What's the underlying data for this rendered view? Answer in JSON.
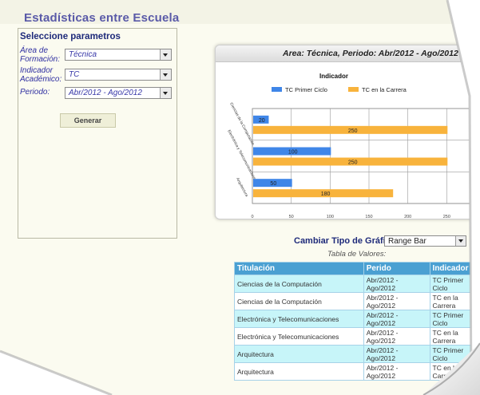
{
  "page": {
    "title": "Estadísticas entre Escuela"
  },
  "filters": {
    "header": "Seleccione parametros",
    "fields": [
      {
        "label": "Área de Formación:",
        "value": "Técnica"
      },
      {
        "label": "Indicador Académico:",
        "value": "TC"
      },
      {
        "label": "Periodo:",
        "value": "Abr/2012 - Ago/2012"
      }
    ],
    "generate_button": "Generar"
  },
  "chart_panel": {
    "title": "Area: Técnica, Periodo: Abr/2012 - Ago/2012"
  },
  "chart_data": {
    "type": "bar",
    "orientation": "horizontal",
    "title": "Indicador",
    "categories": [
      "Ciencias de la Computación",
      "Electrónica y Telecomunicaciones",
      "Arquitectura"
    ],
    "category_tick_labels": [
      "Ciencias de la Computación",
      "Electrónica y Telecomunicaciones",
      "Arquitectura"
    ],
    "series": [
      {
        "name": "TC Primer Ciclo",
        "values": [
          20,
          100,
          50
        ],
        "color": "#3f86e8"
      },
      {
        "name": "TC en la Carrera",
        "values": [
          250,
          250,
          180
        ],
        "color": "#f8b33c"
      }
    ],
    "data_labels": [
      [
        "20",
        "100",
        "50"
      ],
      [
        "250",
        "250",
        "180"
      ]
    ],
    "xlim": [
      0,
      300
    ],
    "x_ticks": [
      "0",
      "50",
      "100",
      "150",
      "200",
      "250"
    ],
    "grid": true,
    "legend_position": "top"
  },
  "chart_type_selector": {
    "label": "Cambiar Tipo de Gráfica:",
    "value": "Range Bar"
  },
  "table": {
    "caption": "Tabla de Valores:",
    "headers": [
      "Titulación",
      "Perido",
      "Indicador"
    ],
    "rows": [
      [
        "Ciencias de la Computación",
        "Abr/2012 - Ago/2012",
        "TC Primer Ciclo"
      ],
      [
        "Ciencias de la Computación",
        "Abr/2012 - Ago/2012",
        "TC en la Carrera"
      ],
      [
        "Electrónica y Telecomunicaciones",
        "Abr/2012 - Ago/2012",
        "TC Primer Ciclo"
      ],
      [
        "Electrónica y Telecomunicaciones",
        "Abr/2012 - Ago/2012",
        "TC en la Carrera"
      ],
      [
        "Arquitectura",
        "Abr/2012 - Ago/2012",
        "TC Primer Ciclo"
      ],
      [
        "Arquitectura",
        "Abr/2012 - Ago/2012",
        "TC en la Carrera"
      ]
    ]
  }
}
